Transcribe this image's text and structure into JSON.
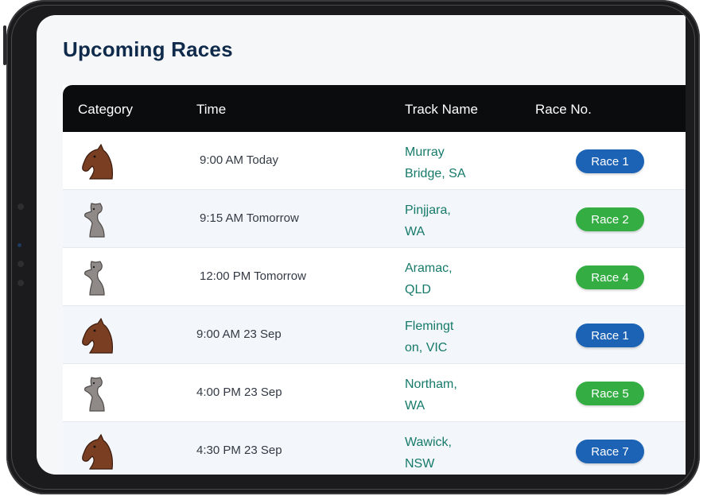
{
  "title": "Upcoming Races",
  "columns": [
    "Category",
    "Time",
    "Track Name",
    "Race No."
  ],
  "colors": {
    "header_bg": "#0b0c0e",
    "title": "#0f2a4a",
    "track_text": "#167a6a",
    "race_blue": "#1c62b5",
    "race_green": "#34ad43",
    "horse_icon": "#7a3e22",
    "greyhound_icon": "#8f8a87"
  },
  "races": [
    {
      "category": "horse-icon",
      "time": "9:00 AM Today",
      "track_line1": "Murray",
      "track_line2": "Bridge, SA",
      "race": "Race 1",
      "color": "blue"
    },
    {
      "category": "greyhound-icon",
      "time": "9:15 AM Tomorrow",
      "track_line1": "Pinjjara,",
      "track_line2": "WA",
      "race": "Race 2",
      "color": "green"
    },
    {
      "category": "greyhound-icon",
      "time": "12:00 PM Tomorrow",
      "track_line1": "Aramac,",
      "track_line2": "QLD",
      "race": "Race 4",
      "color": "green"
    },
    {
      "category": "horse-icon",
      "time": "9:00 AM 23 Sep",
      "track_line1": "Flemingt",
      "track_line2": "on, VIC",
      "race": "Race 1",
      "color": "blue"
    },
    {
      "category": "greyhound-icon",
      "time": "4:00 PM 23 Sep",
      "track_line1": "Northam,",
      "track_line2": "WA",
      "race": "Race 5",
      "color": "green"
    },
    {
      "category": "horse-icon",
      "time": "4:30 PM 23 Sep",
      "track_line1": "Wawick,",
      "track_line2": "NSW",
      "race": "Race 7",
      "color": "blue"
    }
  ]
}
